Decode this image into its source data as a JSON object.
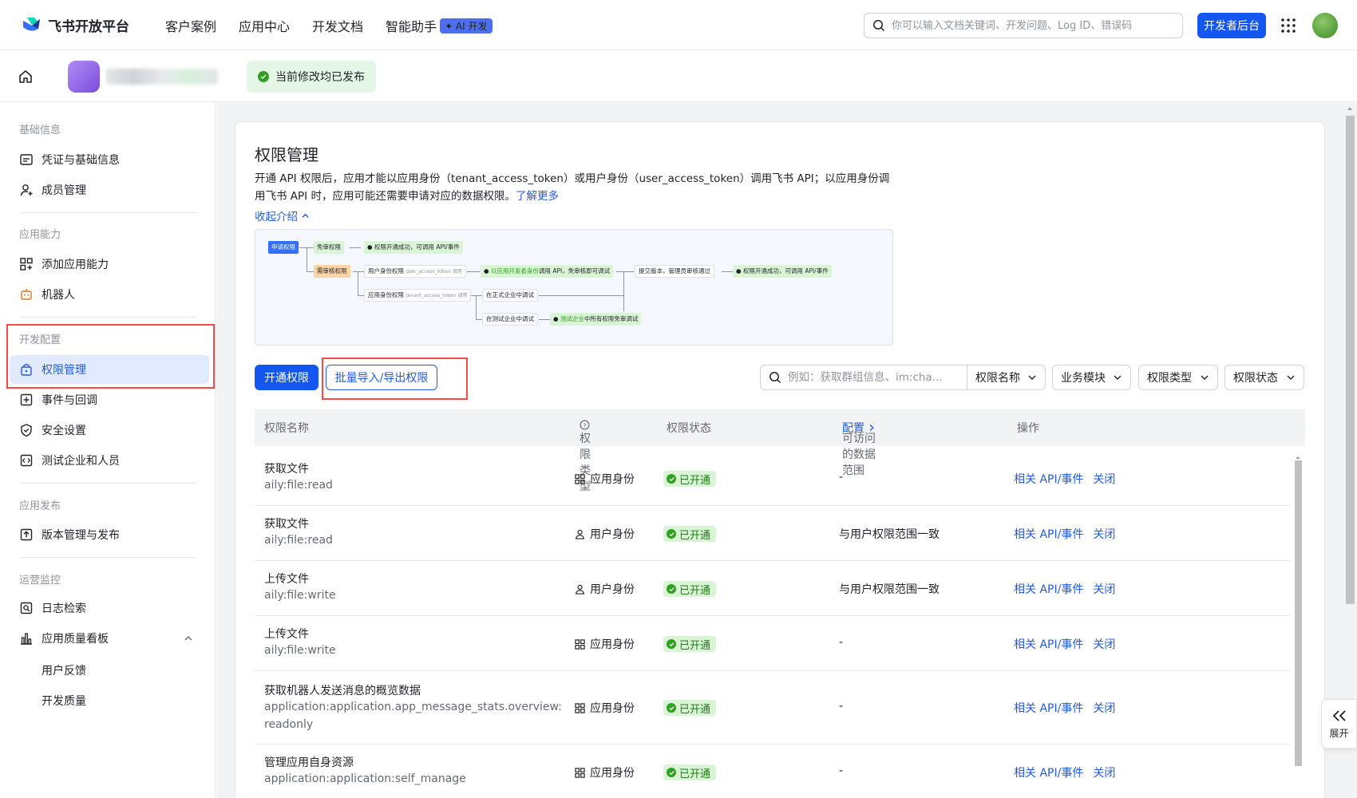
{
  "brand": {
    "name": "飞书开放平台"
  },
  "nav": {
    "links": [
      "客户案例",
      "应用中心",
      "开发文档",
      "智能助手"
    ],
    "ai_badge": "✦ AI 开发",
    "search_placeholder": "你可以输入文档关键词、开发问题、Log ID、错误码",
    "dev_console_label": "开发者后台"
  },
  "subbar": {
    "published_text": "当前修改均已发布"
  },
  "sidebar": {
    "sections": [
      {
        "title": "基础信息",
        "items": [
          "凭证与基础信息",
          "成员管理"
        ]
      },
      {
        "title": "应用能力",
        "items": [
          "添加应用能力",
          "机器人"
        ]
      },
      {
        "title": "开发配置",
        "items": [
          "权限管理",
          "事件与回调",
          "安全设置",
          "测试企业和人员"
        ]
      },
      {
        "title": "应用发布",
        "items": [
          "版本管理与发布"
        ]
      },
      {
        "title": "运营监控",
        "items": [
          "日志检索",
          "应用质量看板"
        ],
        "subitems": [
          "用户反馈",
          "开发质量"
        ]
      }
    ],
    "active_item": "权限管理"
  },
  "main": {
    "title": "权限管理",
    "intro": "开通 API 权限后，应用才能以应用身份（tenant_access_token）或用户身份（user_access_token）调用飞书 API；以应用身份调用飞书 API 时，应用可能还需要申请对应的数据权限。",
    "learn_more": "了解更多",
    "collapse_label": "收起介绍",
    "flow": {
      "apply": "申请权限",
      "free": "免审权限",
      "free_result": "权限开通成功，可调用 API/事件",
      "review": "需审核权限",
      "user_identity": "用户身份权限",
      "user_token": "user_access_token",
      "call": "调用",
      "app_identity": "应用身份权限",
      "tenant_token": "tenant_access_token",
      "dev_debug_1": "以应用开发者身份",
      "dev_debug_2": "调用 API，免审核即可调试",
      "submit": "提交版本，管理员审核通过",
      "final_result": "权限开通成功，可调用 API/事件",
      "prod_debug": "在正式企业中调试",
      "test_debug": "在测试企业中调试",
      "test_result_1": "测试企业",
      "test_result_2": "中所有权限免审调试"
    },
    "open_btn": "开通权限",
    "batch_btn": "批量导入/导出权限",
    "filter_placeholder": "例如：获取群组信息、im:cha...",
    "dropdowns": [
      "权限名称",
      "业务模块",
      "权限类型",
      "权限状态"
    ],
    "columns": {
      "name": "权限名称",
      "type": "权限类型",
      "status": "权限状态",
      "scope": "可访问的数据范围",
      "scope_link": "配置",
      "ops": "操作"
    },
    "rows": [
      {
        "name": "获取文件",
        "code": "aily:file:read",
        "type": "应用身份",
        "type_icon": "grid-icon",
        "status": "已开通",
        "scope": "-",
        "op1": "相关 API/事件",
        "op2": "关闭"
      },
      {
        "name": "获取文件",
        "code": "aily:file:read",
        "type": "用户身份",
        "type_icon": "user-icon",
        "status": "已开通",
        "scope": "与用户权限范围一致",
        "op1": "相关 API/事件",
        "op2": "关闭"
      },
      {
        "name": "上传文件",
        "code": "aily:file:write",
        "type": "用户身份",
        "type_icon": "user-icon",
        "status": "已开通",
        "scope": "与用户权限范围一致",
        "op1": "相关 API/事件",
        "op2": "关闭"
      },
      {
        "name": "上传文件",
        "code": "aily:file:write",
        "type": "应用身份",
        "type_icon": "grid-icon",
        "status": "已开通",
        "scope": "-",
        "op1": "相关 API/事件",
        "op2": "关闭"
      },
      {
        "name": "获取机器人发送消息的概览数据",
        "code": "application:application.app_message_stats.overview:readonly",
        "type": "应用身份",
        "type_icon": "grid-icon",
        "status": "已开通",
        "scope": "-",
        "op1": "相关 API/事件",
        "op2": "关闭"
      },
      {
        "name": "管理应用自身资源",
        "code": "application:application:self_manage",
        "type": "应用身份",
        "type_icon": "grid-icon",
        "status": "已开通",
        "scope": "-",
        "op1": "相关 API/事件",
        "op2": "关闭"
      }
    ]
  },
  "expand_label": "展开",
  "colors": {
    "primary": "#1456f0",
    "link": "#245bdb",
    "success_bg": "#d9f5d6",
    "highlight_red": "#f54a45"
  }
}
